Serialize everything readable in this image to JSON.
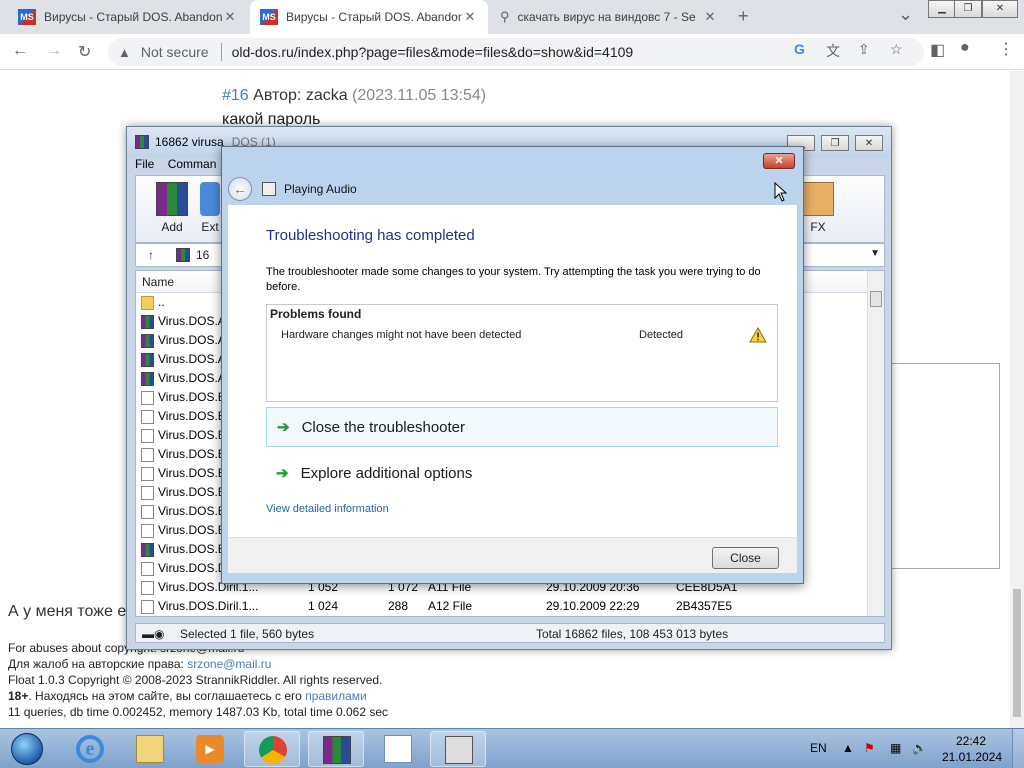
{
  "browser": {
    "tabs": [
      {
        "title": "Вирусы - Старый DOS. Abandon",
        "icon": "ms-favicon",
        "active": false
      },
      {
        "title": "Вирусы - Старый DOS. Abandon",
        "icon": "ms-favicon",
        "active": true
      },
      {
        "title": "скачать вирус на виндовс 7 - Se",
        "icon": "search-icon",
        "active": false
      }
    ],
    "new_tab": "+",
    "tab_list": "⌄",
    "omnibox": {
      "security": "Not secure",
      "url": "old-dos.ru/index.php?page=files&mode=files&do=show&id=4109"
    }
  },
  "forum": {
    "post_num": "#16",
    "author_label": "Автор: zacka",
    "date": "(2023.11.05 13:54)",
    "text": "какой пароль",
    "comment2": "А у меня тоже е",
    "footer": {
      "abuse": "For abuses about copyright: srzone@mail.ru",
      "ru_abuse": "Для жалоб на авторские права:",
      "ru_email": "srzone@mail.ru",
      "copyright": "Float 1.0.3 Copyright © 2008-2023 StrannikRiddler. All rights reserved.",
      "age": "18+",
      "agree": ". Находясь на этом сайте, вы соглашаетесь с его",
      "rules": "правилами",
      "stats": "11 queries, db time 0.002452, memory 1487.03 Kb, total time 0.062 sec"
    }
  },
  "winrar": {
    "title": "16862 virusa",
    "title_hidden_part": "DOS (1)",
    "menu": [
      "File",
      "Comman"
    ],
    "ribbon": [
      {
        "label": "Add"
      },
      {
        "label": "Ext"
      },
      {
        "label": "FX"
      }
    ],
    "path": "16",
    "col_name": "Name",
    "rows": [
      {
        "name": "..",
        "icon": "folder"
      },
      {
        "name": "Virus.DOS.A",
        "icon": "rar"
      },
      {
        "name": "Virus.DOS.A",
        "icon": "rar"
      },
      {
        "name": "Virus.DOS.A",
        "icon": "rar"
      },
      {
        "name": "Virus.DOS.A",
        "icon": "rar"
      },
      {
        "name": "Virus.DOS.B",
        "icon": "doc"
      },
      {
        "name": "Virus.DOS.B",
        "icon": "doc"
      },
      {
        "name": "Virus.DOS.B",
        "icon": "doc"
      },
      {
        "name": "Virus.DOS.B",
        "icon": "doc"
      },
      {
        "name": "Virus.DOS.B",
        "icon": "doc"
      },
      {
        "name": "Virus.DOS.B",
        "icon": "doc"
      },
      {
        "name": "Virus.DOS.B",
        "icon": "doc"
      },
      {
        "name": "Virus.DOS.B",
        "icon": "doc"
      },
      {
        "name": "Virus.DOS.B",
        "icon": "rar"
      },
      {
        "name": "Virus.DOS.D",
        "icon": "doc"
      },
      {
        "name": "Virus.DOS.Diril.1...",
        "icon": "doc",
        "size": "1 052",
        "packed": "1 072",
        "type": "A11 File",
        "modified": "29.10.2009 20:36",
        "crc": "CEE8D5A1"
      },
      {
        "name": "Virus.DOS.Diril.1...",
        "icon": "doc",
        "size": "1 024",
        "packed": "288",
        "type": "A12 File",
        "modified": "29.10.2009 22:29",
        "crc": "2B4357E5"
      }
    ],
    "status_left": "Selected 1 file, 560 bytes",
    "status_right": "Total 16862 files, 108 453 013 bytes"
  },
  "dialog": {
    "title": "Playing Audio",
    "heading": "Troubleshooting has completed",
    "description": "The troubleshooter made some changes to your system. Try attempting the task you were trying to do before.",
    "problems_header": "Problems found",
    "problem": "Hardware changes might not have been detected",
    "problem_status": "Detected",
    "option1": "Close the troubleshooter",
    "option2": "Explore additional options",
    "details_link": "View detailed information",
    "close_button": "Close"
  },
  "taskbar": {
    "lang": "EN",
    "time": "22:42",
    "date": "21.01.2024"
  }
}
